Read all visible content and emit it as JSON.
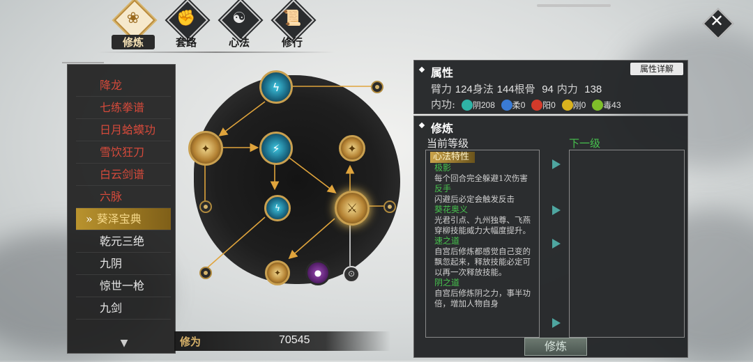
{
  "tabs": [
    {
      "label": "修炼",
      "icon": "lotus-icon",
      "glyph": "❀",
      "active": true
    },
    {
      "label": "套路",
      "icon": "fist-icon",
      "glyph": "✊",
      "active": false
    },
    {
      "label": "心法",
      "icon": "yin-yang-icon",
      "glyph": "☯",
      "active": false
    },
    {
      "label": "修行",
      "icon": "scroll-icon",
      "glyph": "📜",
      "active": false
    }
  ],
  "close_glyph": "✕",
  "sidebar": {
    "items": [
      {
        "label": "降龙",
        "color": "red"
      },
      {
        "label": "七练拳谱",
        "color": "red"
      },
      {
        "label": "日月蛤蟆功",
        "color": "red"
      },
      {
        "label": "雪饮狂刀",
        "color": "red"
      },
      {
        "label": "白云剑谱",
        "color": "red"
      },
      {
        "label": "六脉",
        "color": "red"
      },
      {
        "label": "葵泽宝典",
        "color": "selected"
      },
      {
        "label": "乾元三绝",
        "color": "white"
      },
      {
        "label": "九阴",
        "color": "white"
      },
      {
        "label": "惊世一枪",
        "color": "white"
      },
      {
        "label": "九剑",
        "color": "white"
      }
    ],
    "selected_arrow": "»",
    "scroll_glyph": "▼"
  },
  "xiuwei": {
    "label": "修为",
    "value": "70545"
  },
  "attributes": {
    "title": "属性",
    "detail_button": "属性详解",
    "stats": [
      {
        "label": "臂力",
        "value": "124"
      },
      {
        "label": "身法",
        "value": "144"
      },
      {
        "label": "根骨",
        "value": "94"
      },
      {
        "label": "内力",
        "value": "138"
      }
    ],
    "neigong_label": "内功:",
    "neigong": [
      {
        "name": "阴",
        "value": "208",
        "color": "#2fb3a6"
      },
      {
        "name": "柔",
        "value": "0",
        "color": "#3a7bd5"
      },
      {
        "name": "阳",
        "value": "0",
        "color": "#d23a2a"
      },
      {
        "name": "刚",
        "value": "0",
        "color": "#d9b21e"
      },
      {
        "name": "毒",
        "value": "43",
        "color": "#7fbf2a"
      }
    ]
  },
  "cultivation": {
    "title": "修炼",
    "current_level": "当前等级",
    "next_level": "下一级",
    "section": "心法特性",
    "entries": [
      {
        "name": "极影",
        "desc": "每个回合完全躲避1次伤害"
      },
      {
        "name": "反手",
        "desc": "闪避后必定会触发反击"
      },
      {
        "name": "葵花奥义",
        "desc": "光君引点、九州独尊、飞燕穿柳技能威力大幅度提升。"
      },
      {
        "name": "速之道",
        "desc": "自宫后修炼都感觉自己变的飘忽起来，释放技能必定可以再一次释放技能。"
      },
      {
        "name": "阴之道",
        "desc": "自宫后修炼阴之力，事半功倍，增加人物自身"
      }
    ],
    "button": "修炼"
  }
}
